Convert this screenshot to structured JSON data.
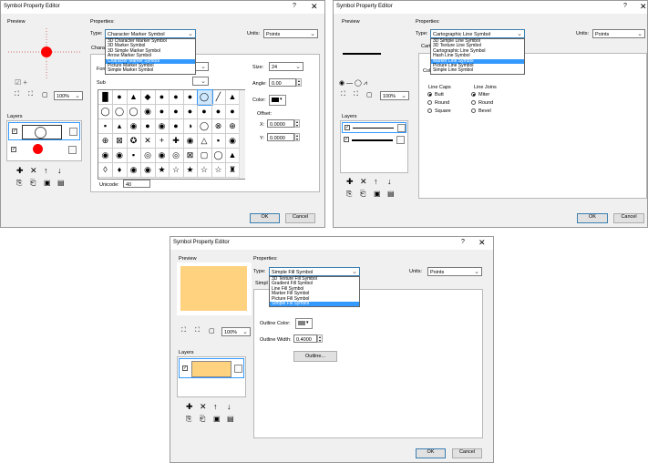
{
  "dialog1": {
    "title": "Symbol Property Editor",
    "help_glyph": "?",
    "close_glyph": "✕",
    "preview_label": "Preview",
    "properties_label": "Properties:",
    "type_label": "Type:",
    "type_value": "Character Marker Symbol",
    "units_label": "Units:",
    "units_value": "Points",
    "type_options": [
      "3D Character Marker Symbol",
      "3D Marker Symbol",
      "3D Simple Marker Symbol",
      "Arrow Marker Symbol",
      "Character Marker Symbol",
      "Picture Marker Symbol",
      "Simple Marker Symbol"
    ],
    "type_selected_index": 4,
    "obscured_tab": "Chara",
    "obscured_font": "Fon",
    "obscured_subset": "Sub",
    "zoom_value": "100%",
    "layers_label": "Layers",
    "size_label": "Size:",
    "size_value": "24",
    "angle_label": "Angle:",
    "angle_value": "0.00",
    "color_label": "Color:",
    "color_value": "#000000",
    "offset_label": "Offset:",
    "x_label": "X:",
    "x_value": "0.0000",
    "y_label": "Y:",
    "y_value": "0.0000",
    "unicode_label": "Unicode:",
    "unicode_value": "40",
    "ok_label": "OK",
    "cancel_label": "Cancel",
    "glyph_rows": [
      "█●▲◆●●●◯╱▲",
      "◯◯◯◉●●●●●●",
      "▪▴◉●◉●◑◯⊗⊕",
      "⊕⊠✪✕+✚◉△▪◉",
      "◉◉▪◎◉◎⊠▢◯▲",
      "◊♦◉◉★☆★☆☆♜"
    ],
    "preview_marker_color": "#ff0000"
  },
  "dialog2": {
    "title": "Symbol Property Editor",
    "help_glyph": "?",
    "close_glyph": "✕",
    "preview_label": "Preview",
    "properties_label": "Properties:",
    "type_label": "Type:",
    "type_value": "Cartographic Line Symbol",
    "units_label": "Units:",
    "units_value": "Points",
    "type_options": [
      "3D Simple Line Symbol",
      "3D Texture Line Symbol",
      "Cartographic Line Symbol",
      "Hash Line Symbol",
      "Marker Line Symbol",
      "Picture Line Symbol",
      "Simple Line Symbol"
    ],
    "type_selected_index": 4,
    "obscured_tab": "Carto",
    "obscured_color": "Colo",
    "zoom_value": "100%",
    "layers_label": "Layers",
    "line_caps_label": "Line Caps",
    "line_caps": [
      "Butt",
      "Round",
      "Square"
    ],
    "line_caps_selected": 0,
    "line_joins_label": "Line Joins",
    "line_joins": [
      "Miter",
      "Round",
      "Bevel"
    ],
    "line_joins_selected": 0,
    "ok_label": "OK",
    "cancel_label": "Cancel"
  },
  "dialog3": {
    "title": "Symbol Property Editor",
    "help_glyph": "?",
    "close_glyph": "✕",
    "preview_label": "Preview",
    "properties_label": "Properties:",
    "type_label": "Type:",
    "type_value": "Simple Fill Symbol",
    "units_label": "Units:",
    "units_value": "Points",
    "type_options": [
      "3D Texture Fill Symbol",
      "Gradient Fill Symbol",
      "Line Fill Symbol",
      "Marker Fill Symbol",
      "Picture Fill Symbol",
      "Simple Fill Symbol"
    ],
    "type_selected_index": 5,
    "obscured_tab": "Simpl",
    "zoom_value": "100%",
    "layers_label": "Layers",
    "outline_color_label": "Outline Color:",
    "outline_color_value": "#808080",
    "outline_width_label": "Outline Width:",
    "outline_width_value": "0.4000",
    "outline_button_label": "Outline...",
    "fill_color": "#ffd27f",
    "ok_label": "OK",
    "cancel_label": "Cancel"
  }
}
